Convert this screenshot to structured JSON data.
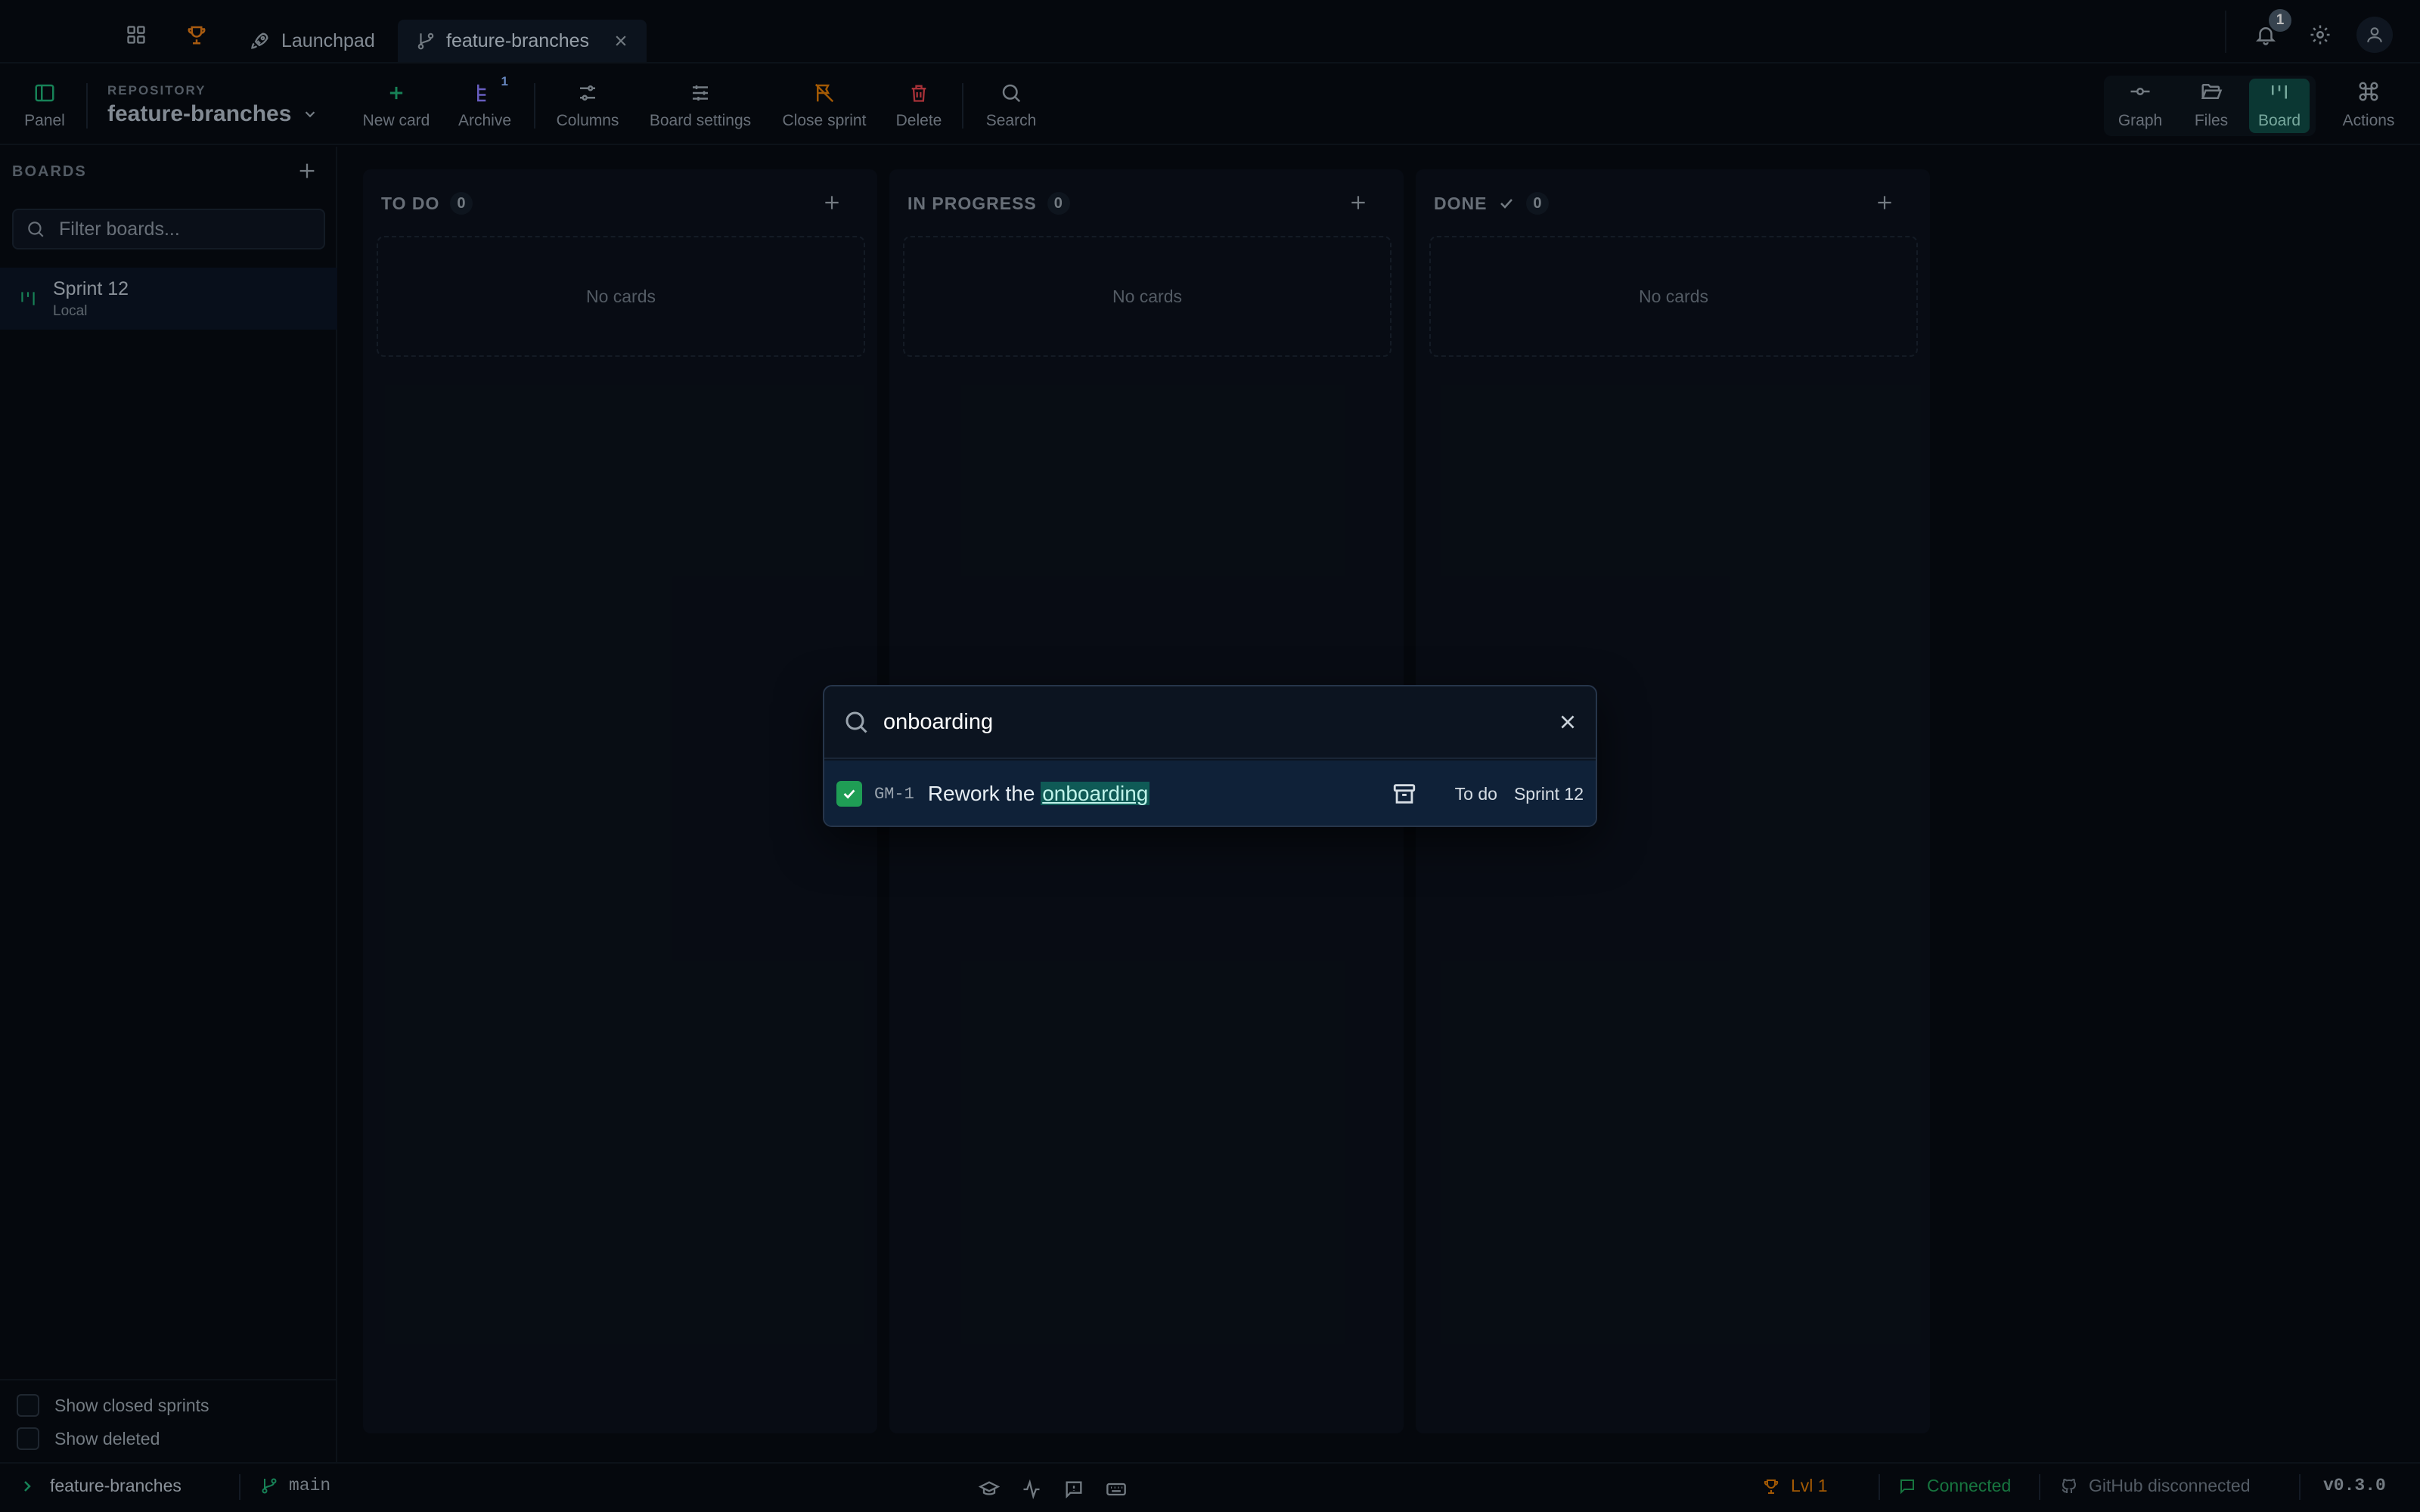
{
  "tabbar": {
    "tabs": [
      {
        "label": "Launchpad"
      },
      {
        "label": "feature-branches"
      }
    ],
    "notification_count": "1"
  },
  "toolbar": {
    "panel_label": "Panel",
    "repository_label": "REPOSITORY",
    "repository_name": "feature-branches",
    "new_card_label": "New card",
    "archive_label": "Archive",
    "archive_badge": "1",
    "columns_label": "Columns",
    "board_settings_label": "Board settings",
    "close_sprint_label": "Close sprint",
    "delete_label": "Delete",
    "search_label": "Search",
    "views": {
      "graph": "Graph",
      "files": "Files",
      "board": "Board",
      "actions": "Actions"
    }
  },
  "sidebar": {
    "boards_label": "BOARDS",
    "filter_placeholder": "Filter boards...",
    "boards": [
      {
        "name": "Sprint 12",
        "sub": "Local"
      }
    ],
    "show_closed_sprints": "Show closed sprints",
    "show_deleted": "Show deleted"
  },
  "board": {
    "columns": [
      {
        "title": "TO DO",
        "count": "0",
        "empty_text": "No cards"
      },
      {
        "title": "IN PROGRESS",
        "count": "0",
        "empty_text": "No cards"
      },
      {
        "title": "DONE",
        "count": "0",
        "empty_text": "No cards"
      }
    ]
  },
  "search_modal": {
    "query": "onboarding",
    "results": [
      {
        "id": "GM-1",
        "title_prefix": "Rework the ",
        "title_match": "onboarding",
        "status": "To do",
        "sprint": "Sprint 12"
      }
    ]
  },
  "statusbar": {
    "repo": "feature-branches",
    "branch": "main",
    "level": "Lvl 1",
    "connection": "Connected",
    "github": "GitHub disconnected",
    "version": "v0.3.0"
  },
  "colors": {
    "accent_green": "#1fae74",
    "warn_orange": "#d97706",
    "danger_red": "#e0424b",
    "highlight_teal": "#0f5a56"
  }
}
